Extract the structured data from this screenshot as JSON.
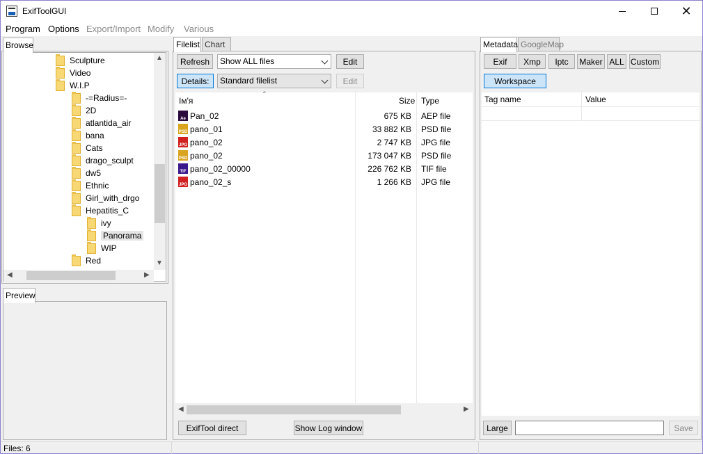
{
  "window": {
    "title": "ExifToolGUI"
  },
  "menu": [
    {
      "label": "Program",
      "enabled": true
    },
    {
      "label": "Options",
      "enabled": true
    },
    {
      "label": "Export/Import",
      "enabled": false
    },
    {
      "label": "Modify",
      "enabled": false
    },
    {
      "label": "Various",
      "enabled": false
    }
  ],
  "left": {
    "browse_tab": "Browse",
    "preview_tab": "Preview",
    "tree": [
      {
        "label": "Sculpture",
        "level": 1
      },
      {
        "label": "Video",
        "level": 1
      },
      {
        "label": "W.I.P",
        "level": 1
      },
      {
        "label": "-=Radius=-",
        "level": 2
      },
      {
        "label": "2D",
        "level": 2
      },
      {
        "label": "atlantida_air",
        "level": 2
      },
      {
        "label": "bana",
        "level": 2
      },
      {
        "label": "Cats",
        "level": 2
      },
      {
        "label": "drago_sculpt",
        "level": 2
      },
      {
        "label": "dw5",
        "level": 2
      },
      {
        "label": "Ethnic",
        "level": 2
      },
      {
        "label": "Girl_with_drgo",
        "level": 2
      },
      {
        "label": "Hepatitis_C",
        "level": 2
      },
      {
        "label": "ivy",
        "level": 3
      },
      {
        "label": "Panorama",
        "level": 3,
        "selected": true
      },
      {
        "label": "WIP",
        "level": 3
      },
      {
        "label": "Red",
        "level": 2
      }
    ]
  },
  "center": {
    "tabs": {
      "filelist": "Filelist",
      "chart": "Chart"
    },
    "refresh_label": "Refresh",
    "filter_value": "Show ALL files",
    "edit_label": "Edit",
    "details_label": "Details:",
    "view_value": "Standard filelist",
    "edit2_label": "Edit",
    "columns": {
      "name": "Ім'я",
      "size": "Size",
      "type": "Type"
    },
    "files": [
      {
        "name": "Pan_02",
        "size": "675 KB",
        "type": "AEP file",
        "icon": "aep-file-icon",
        "icon_text": "Ae",
        "color": "#2b0a3d"
      },
      {
        "name": "pano_01",
        "size": "33 882 KB",
        "type": "PSD file",
        "icon": "psd-file-icon",
        "icon_text": "PSD",
        "color": "#d9a520"
      },
      {
        "name": "pano_02",
        "size": "2 747 KB",
        "type": "JPG file",
        "icon": "jpg-file-icon",
        "icon_text": "JPG",
        "color": "#d02020"
      },
      {
        "name": "pano_02",
        "size": "173 047 KB",
        "type": "PSD file",
        "icon": "psd-file-icon",
        "icon_text": "PSD",
        "color": "#d9a520"
      },
      {
        "name": "pano_02_00000",
        "size": "226 762 KB",
        "type": "TIF file",
        "icon": "tif-file-icon",
        "icon_text": "TIF",
        "color": "#3a1a8a"
      },
      {
        "name": "pano_02_s",
        "size": "1 266 KB",
        "type": "JPG file",
        "icon": "jpg-file-icon",
        "icon_text": "JPG",
        "color": "#d02020"
      }
    ],
    "exiftool_direct_label": "ExifTool direct",
    "show_log_label": "Show Log window"
  },
  "right": {
    "tabs": {
      "metadata": "Metadata",
      "googlemap": "GoogleMap"
    },
    "buttons": [
      "Exif",
      "Xmp",
      "Iptc",
      "Maker",
      "ALL",
      "Custom"
    ],
    "workspace_label": "Workspace",
    "columns": {
      "tag": "Tag name",
      "value": "Value"
    },
    "large_label": "Large",
    "save_label": "Save",
    "value_input": ""
  },
  "status": {
    "text": "Files: 6"
  }
}
